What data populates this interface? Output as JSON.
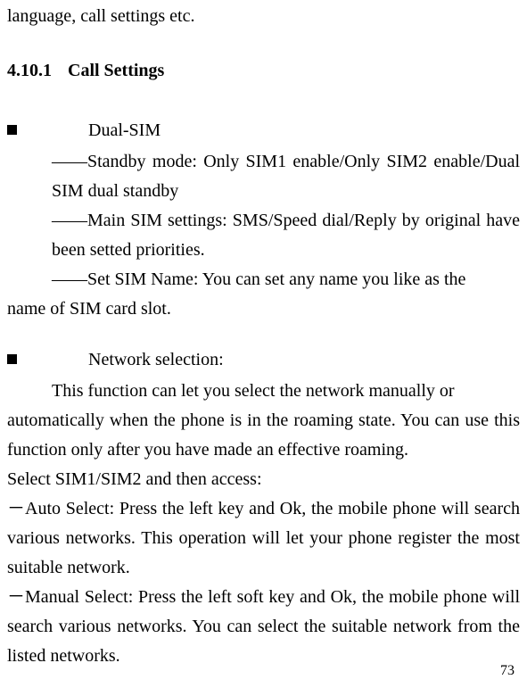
{
  "top_line": "language, call settings etc.",
  "section": {
    "number": "4.10.1",
    "title": "Call Settings"
  },
  "dual_sim": {
    "heading": "Dual-SIM",
    "standby": "――Standby mode: Only SIM1 enable/Only SIM2 enable/Dual SIM dual standby",
    "main_sim": "――Main SIM settings: SMS/Speed dial/Reply by original have been setted priorities.",
    "set_name_part1": "――Set SIM Name: You can set any name you like as the",
    "set_name_part2": "name of SIM card slot."
  },
  "network": {
    "heading": "Network selection:",
    "intro_part1": "This function can let you select the network manually or",
    "intro_rest": "automatically when the phone is in the roaming state. You can use this function only after you have made an effective roaming.",
    "select_line": "Select SIM1/SIM2 and then access:",
    "auto": "－Auto Select: Press the left key and Ok, the mobile phone will search various networks. This operation will let your phone register the most suitable network.",
    "manual": "－Manual Select: Press the left soft key and Ok, the mobile phone will search various networks. You can select the suitable network from the listed networks."
  },
  "page_number": "73"
}
